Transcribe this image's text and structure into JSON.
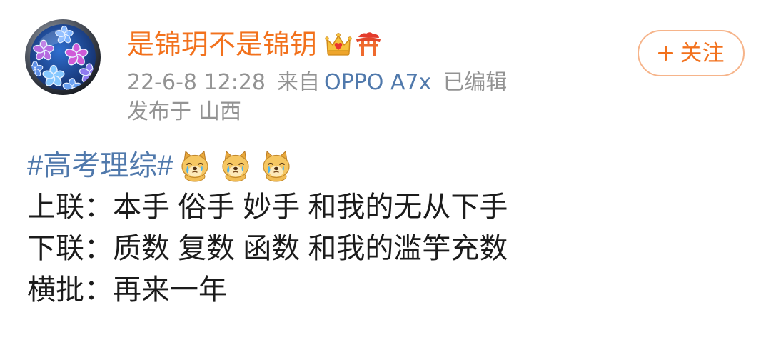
{
  "colors": {
    "background": "#ffffff",
    "author_name": "#f2711c",
    "follow_accent": "#f2711c",
    "follow_border": "#f6b48a",
    "link_blue": "#5079ac",
    "meta_gray": "#939393",
    "body_text": "#1b1b1b"
  },
  "post": {
    "author": {
      "name": "是锦玥不是锦钥",
      "badges": [
        "crown-heart-icon",
        "torii-gate-icon"
      ]
    },
    "follow_button": {
      "icon": "plus-icon",
      "label": "关注"
    },
    "meta": {
      "timestamp": "22-6-8 12:28",
      "source_prefix": "来自",
      "device": "OPPO A7x",
      "edited": "已编辑",
      "location_prefix": "发布于",
      "location": "山西"
    },
    "body": {
      "hashtag": "#高考理综#",
      "hashtag_emojis": [
        "crying-doge-icon",
        "crying-doge-icon",
        "crying-doge-icon"
      ],
      "lines": [
        "上联：本手 俗手 妙手 和我的无从下手",
        "下联：质数 复数 函数 和我的滥竽充数",
        "横批：再来一年"
      ]
    }
  }
}
